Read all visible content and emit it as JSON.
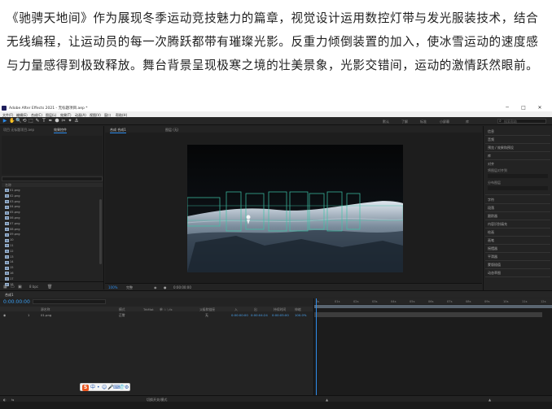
{
  "article": {
    "paragraph": "《驰骋天地间》作为展现冬季运动竞技魅力的篇章，视觉设计运用数控灯带与发光服装技术，结合无线编程，让运动员的每一次腾跃都带有璀璨光影。反重力倾倒装置的加入，使冰雪运动的速度感与力量感得到极致释放。舞台背景呈现极寒之境的壮美景象，光影交错间，运动的激情跃然眼前。"
  },
  "window": {
    "title": "Adobe After Effects 2021 - 无标题项目.aep *",
    "minimize_glyph": "─",
    "maximize_glyph": "□",
    "close_glyph": "✕"
  },
  "menu": [
    "文件(F)",
    "编辑(E)",
    "合成(C)",
    "图层(L)",
    "效果(T)",
    "动画(A)",
    "视图(V)",
    "窗口",
    "帮助(H)"
  ],
  "toolbar": {
    "tools": [
      "▶",
      "✋",
      "🔍",
      "⟲",
      "⬚",
      "✎",
      "T",
      "✒",
      "⬢",
      "✂",
      "✦",
      "⚓"
    ],
    "workspaces": [
      "默认",
      "了解",
      "标准",
      "小屏幕",
      "库"
    ],
    "search_placeholder": "搜索帮助"
  },
  "project_panel": {
    "tabs": [
      "项目 无标题项目.aep",
      "效果控件"
    ],
    "list_header": "名称",
    "items": [
      "01.png",
      "02.png",
      "03.png",
      "04.png",
      "05.png",
      "06.png",
      "07.png",
      "08.png",
      "09.png",
      "10",
      "11",
      "12",
      "13",
      "14",
      "15",
      "16",
      "17",
      "18",
      "19",
      "20"
    ],
    "bit_depth": "8 bpc"
  },
  "viewer": {
    "tabs": [
      "合成 合成1",
      "图层 (无)"
    ],
    "footer": {
      "zoom": "100%",
      "quality": "完整",
      "timecode": "0:00:00:00"
    }
  },
  "right_panel": {
    "items": [
      "信息",
      "音频",
      "预览 / 效果和预设",
      "库",
      "对齐",
      "字符",
      "段落",
      "跟踪器",
      "内容识别填充",
      "绘画",
      "画笔",
      "摇摆器",
      "平滑器",
      "蒙版插值",
      "动态草图"
    ],
    "align_label": "将图层对齐到",
    "distribute_label": "分布图层"
  },
  "timeline": {
    "tab": "合成1",
    "timecode": "0:00:00:00",
    "columns": [
      "源名称",
      "模式",
      "TrkMat",
      "单 ☆ \\ fx",
      "父级和链接",
      "入",
      "出",
      "持续时间",
      "伸缩"
    ],
    "layer": {
      "index": "1",
      "name": "01.png",
      "mode": "正常",
      "parent": "无",
      "in": "0:00:00:00",
      "out": "0:00:04:24",
      "duration": "0:00:05:00",
      "stretch": "100.0%"
    },
    "ruler_ticks": [
      "0s",
      "01s",
      "02s",
      "03s",
      "04s",
      "05s",
      "06s",
      "07s",
      "08s",
      "09s",
      "10s",
      "11s",
      "12s"
    ],
    "footer": "切换开关/模式"
  },
  "ime_glyphs": [
    "中",
    "•",
    "☺",
    "🎤",
    "⌨",
    "👕",
    "⚙"
  ],
  "colors": {
    "accent": "#2d8ceb",
    "timecode": "#3a9ef0",
    "panel_bg": "#232323"
  }
}
